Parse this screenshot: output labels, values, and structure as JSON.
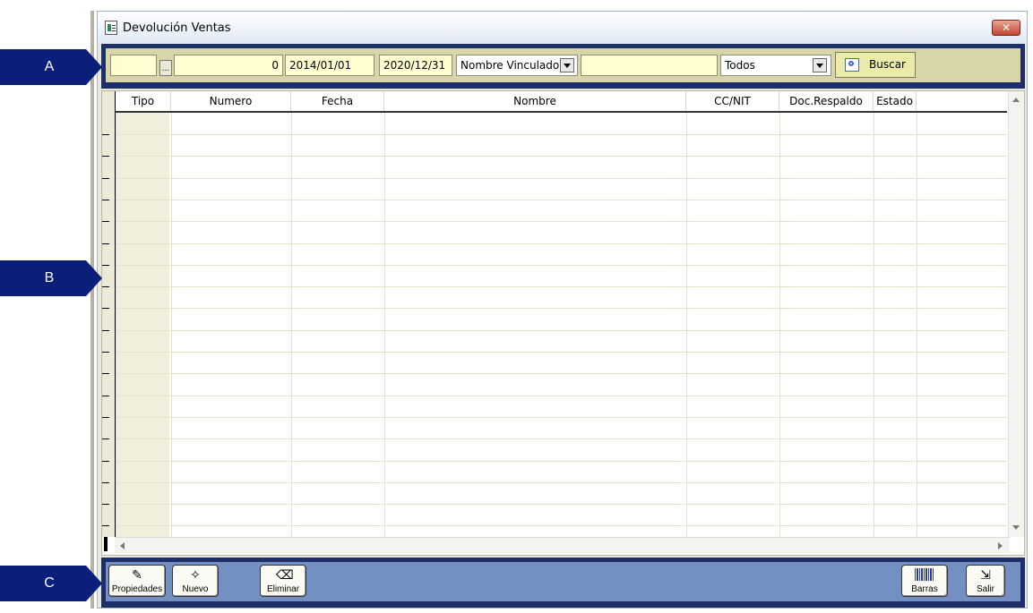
{
  "window": {
    "title": "Devolución Ventas",
    "close_icon": "close-icon"
  },
  "callouts": {
    "a": "A",
    "b": "B",
    "c": "C"
  },
  "filters": {
    "code_value": "",
    "browse_label": "...",
    "number_value": "0",
    "date_from": "2014/01/01",
    "date_to": "2020/12/31",
    "name_filter": "Nombre Vinculado",
    "search_text": "",
    "status_filter": "Todos",
    "search_button": "Buscar"
  },
  "grid": {
    "columns": [
      "Tipo",
      "Numero",
      "Fecha",
      "Nombre",
      "CC/NIT",
      "Doc.Respaldo",
      "Estado"
    ],
    "rows": []
  },
  "actions": {
    "propiedades": "Propiedades",
    "nuevo": "Nuevo",
    "eliminar": "Eliminar",
    "barras": "Barras",
    "salir": "Salir"
  },
  "colors": {
    "frame": "#1d2e69",
    "toolbar_bg": "#d8d6a9",
    "actionbar_bg": "#7390c2",
    "callout": "#0a1f7a"
  }
}
